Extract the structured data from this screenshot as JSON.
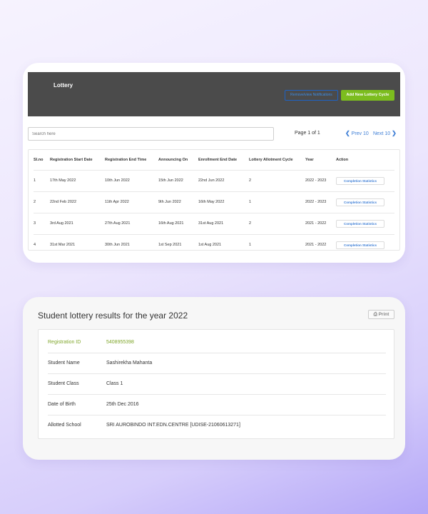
{
  "lottery": {
    "title": "Lottery",
    "remove_label": "Remove/view Notifications",
    "add_label": "Add New Lottery Cycle",
    "search_placeholder": "Search here",
    "pager": {
      "info": "Page 1 of 1",
      "prev": "Prev 10",
      "next": "Next 10"
    },
    "columns": [
      "Sl.no",
      "Registration Start Date",
      "Registration End Time",
      "Announcing On",
      "Enrollment End Date",
      "Lottery Allotment Cycle",
      "Year",
      "Action"
    ],
    "rows": [
      {
        "slno": "1",
        "reg_start": "17th May 2022",
        "reg_end": "10th Jun 2022",
        "announce": "15th Jun 2022",
        "enroll_end": "22nd Jun 2022",
        "cycle": "2",
        "year": "2022 - 2023",
        "action": "Completion Statistics"
      },
      {
        "slno": "2",
        "reg_start": "22nd Feb 2022",
        "reg_end": "11th Apr 2022",
        "announce": "9th Jun 2022",
        "enroll_end": "16th May 2022",
        "cycle": "1",
        "year": "2022 - 2023",
        "action": "Completion Statistics"
      },
      {
        "slno": "3",
        "reg_start": "3rd Aug 2021",
        "reg_end": "27th Aug 2021",
        "announce": "16th Aug 2021",
        "enroll_end": "31st Aug 2021",
        "cycle": "2",
        "year": "2021 - 2022",
        "action": "Completion Statistics"
      },
      {
        "slno": "4",
        "reg_start": "31st Mar 2021",
        "reg_end": "30th Jun 2021",
        "announce": "1st Sep 2021",
        "enroll_end": "1st Aug 2021",
        "cycle": "1",
        "year": "2021 - 2022",
        "action": "Completion Statistics"
      }
    ]
  },
  "results": {
    "title": "Student lottery results for the year 2022",
    "print_label": "Print",
    "fields": [
      {
        "label": "Registration ID",
        "value": "5408955398"
      },
      {
        "label": "Student Name",
        "value": "Sashirekha Mahanta"
      },
      {
        "label": "Student Class",
        "value": "Class 1"
      },
      {
        "label": "Date of Birth",
        "value": "25th Dec 2016"
      },
      {
        "label": "Allotted School",
        "value": "SRI AUROBINDO INT.EDN.CENTRE [UDISE-21060613271]"
      }
    ]
  },
  "colors": {
    "accent_green": "#7cbd1e",
    "link_blue": "#3f7fd6",
    "header_dark": "#4b4b4b",
    "highlight_green": "#7fa62b"
  },
  "icons": {
    "prev": "chevron-left-icon",
    "next": "chevron-right-icon",
    "print": "printer-icon"
  }
}
